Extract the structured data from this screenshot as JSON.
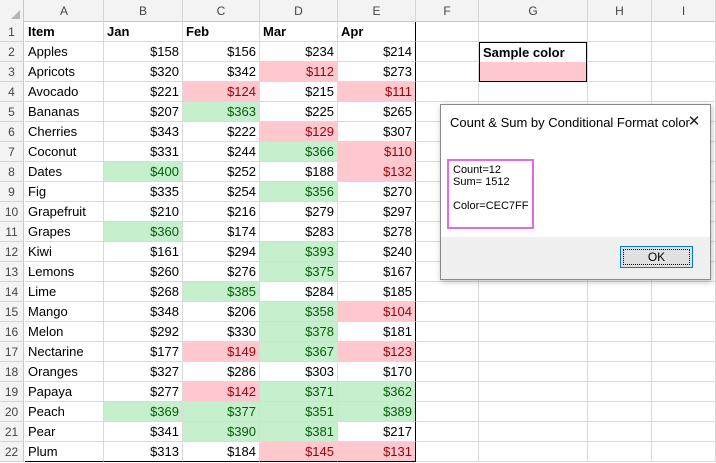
{
  "columns": [
    "A",
    "B",
    "C",
    "D",
    "E",
    "F",
    "G",
    "H",
    "I"
  ],
  "row_numbers": [
    "1",
    "2",
    "3",
    "4",
    "5",
    "6",
    "7",
    "8",
    "9",
    "10",
    "11",
    "12",
    "13",
    "14",
    "15",
    "16",
    "17",
    "18",
    "19",
    "20",
    "21",
    "22"
  ],
  "headers": [
    "Item",
    "Jan",
    "Feb",
    "Mar",
    "Apr"
  ],
  "rows": [
    {
      "item": "Apples",
      "vals": [
        "$158",
        "$156",
        "$234",
        "$214"
      ],
      "fmt": [
        "",
        "",
        "",
        ""
      ]
    },
    {
      "item": "Apricots",
      "vals": [
        "$320",
        "$342",
        "$112",
        "$273"
      ],
      "fmt": [
        "",
        "",
        "red",
        ""
      ]
    },
    {
      "item": "Avocado",
      "vals": [
        "$221",
        "$124",
        "$215",
        "$111"
      ],
      "fmt": [
        "",
        "red",
        "",
        "red"
      ]
    },
    {
      "item": "Bananas",
      "vals": [
        "$207",
        "$363",
        "$225",
        "$265"
      ],
      "fmt": [
        "",
        "green",
        "",
        ""
      ]
    },
    {
      "item": "Cherries",
      "vals": [
        "$343",
        "$222",
        "$129",
        "$307"
      ],
      "fmt": [
        "",
        "",
        "red",
        ""
      ]
    },
    {
      "item": "Coconut",
      "vals": [
        "$331",
        "$244",
        "$366",
        "$110"
      ],
      "fmt": [
        "",
        "",
        "green",
        "red"
      ]
    },
    {
      "item": "Dates",
      "vals": [
        "$400",
        "$252",
        "$188",
        "$132"
      ],
      "fmt": [
        "green",
        "",
        "",
        "red"
      ]
    },
    {
      "item": "Fig",
      "vals": [
        "$335",
        "$254",
        "$356",
        "$270"
      ],
      "fmt": [
        "",
        "",
        "green",
        ""
      ]
    },
    {
      "item": "Grapefruit",
      "vals": [
        "$210",
        "$216",
        "$279",
        "$297"
      ],
      "fmt": [
        "",
        "",
        "",
        ""
      ]
    },
    {
      "item": "Grapes",
      "vals": [
        "$360",
        "$174",
        "$283",
        "$278"
      ],
      "fmt": [
        "green",
        "",
        "",
        ""
      ]
    },
    {
      "item": "Kiwi",
      "vals": [
        "$161",
        "$294",
        "$393",
        "$240"
      ],
      "fmt": [
        "",
        "",
        "green",
        ""
      ]
    },
    {
      "item": "Lemons",
      "vals": [
        "$260",
        "$276",
        "$375",
        "$167"
      ],
      "fmt": [
        "",
        "",
        "green",
        ""
      ]
    },
    {
      "item": "Lime",
      "vals": [
        "$268",
        "$385",
        "$284",
        "$185"
      ],
      "fmt": [
        "",
        "green",
        "",
        ""
      ]
    },
    {
      "item": "Mango",
      "vals": [
        "$348",
        "$206",
        "$358",
        "$104"
      ],
      "fmt": [
        "",
        "",
        "green",
        "red"
      ]
    },
    {
      "item": "Melon",
      "vals": [
        "$292",
        "$330",
        "$378",
        "$181"
      ],
      "fmt": [
        "",
        "",
        "green",
        ""
      ]
    },
    {
      "item": "Nectarine",
      "vals": [
        "$177",
        "$149",
        "$367",
        "$123"
      ],
      "fmt": [
        "",
        "red",
        "green",
        "red"
      ]
    },
    {
      "item": "Oranges",
      "vals": [
        "$327",
        "$286",
        "$303",
        "$170"
      ],
      "fmt": [
        "",
        "",
        "",
        ""
      ]
    },
    {
      "item": "Papaya",
      "vals": [
        "$277",
        "$142",
        "$371",
        "$362"
      ],
      "fmt": [
        "",
        "red",
        "green",
        "green"
      ]
    },
    {
      "item": "Peach",
      "vals": [
        "$369",
        "$377",
        "$351",
        "$389"
      ],
      "fmt": [
        "green",
        "green",
        "green",
        "green"
      ]
    },
    {
      "item": "Pear",
      "vals": [
        "$341",
        "$390",
        "$381",
        "$217"
      ],
      "fmt": [
        "",
        "green",
        "green",
        ""
      ]
    },
    {
      "item": "Plum",
      "vals": [
        "$313",
        "$184",
        "$145",
        "$131"
      ],
      "fmt": [
        "",
        "",
        "red",
        "red"
      ]
    }
  ],
  "sample": {
    "title": "Sample color",
    "swatch_color": "#ffc7ce"
  },
  "dialog": {
    "title": "Count & Sum by Conditional Format color",
    "close_icon": "close-icon",
    "lines": [
      "Count=12",
      "Sum= 1512",
      "",
      "Color=CEC7FF"
    ],
    "ok_label": "OK"
  },
  "colors": {
    "red_fill": "#ffc7ce",
    "red_text": "#9c0006",
    "green_fill": "#c6efce",
    "green_text": "#006100",
    "highlight_border": "#e46ae4"
  }
}
